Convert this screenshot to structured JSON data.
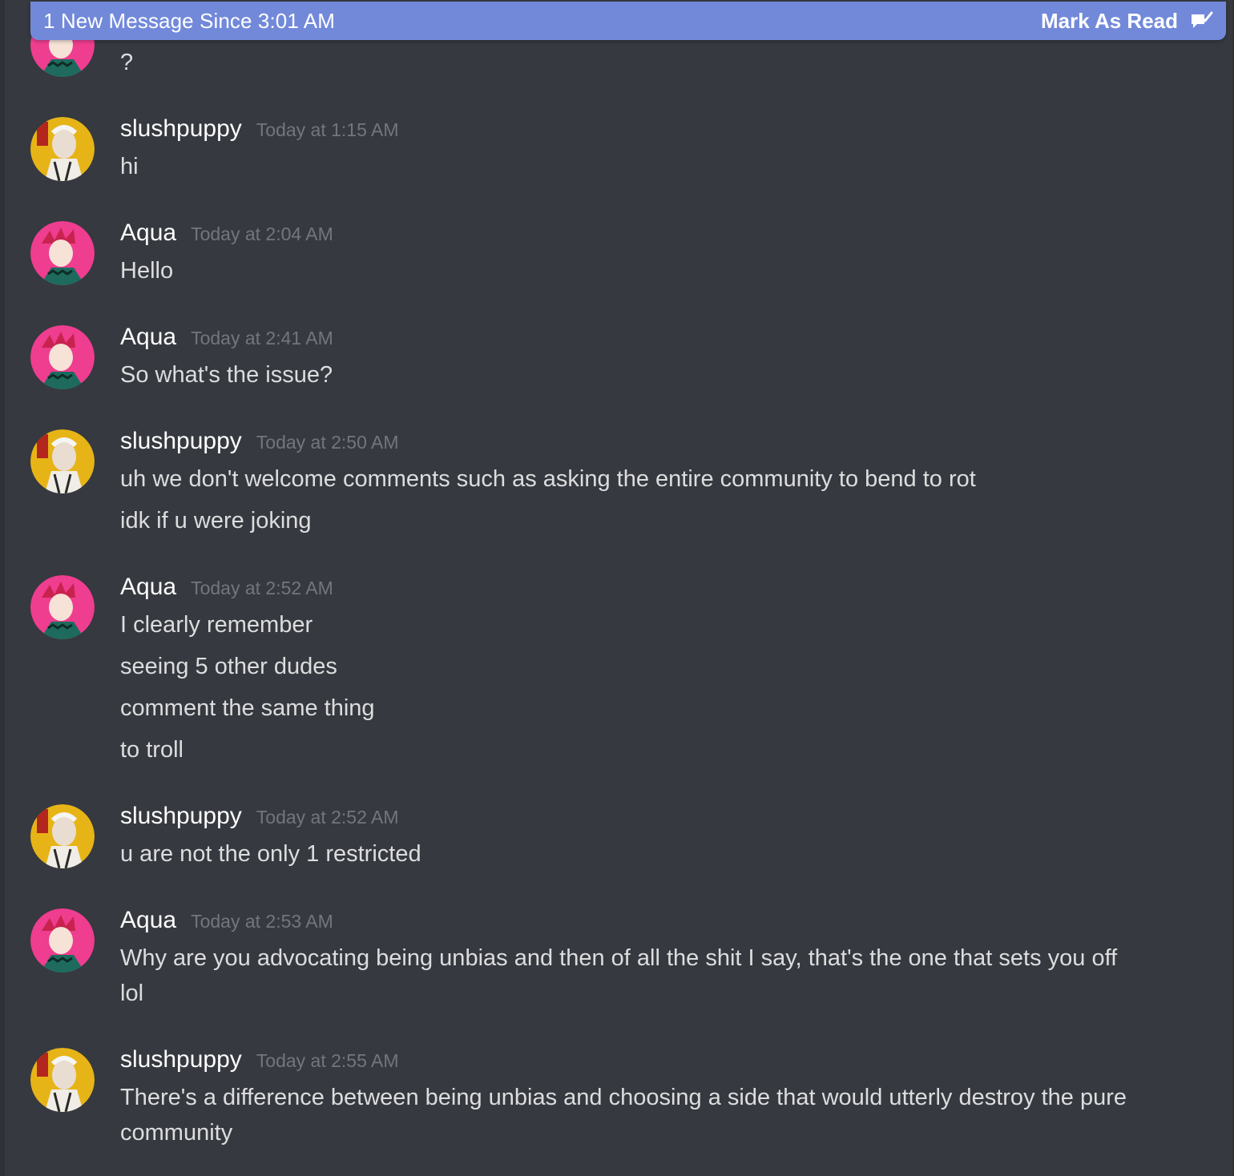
{
  "banner": {
    "text": "1 New Message Since 3:01 AM",
    "action_label": "Mark As Read",
    "color": "#7289da"
  },
  "colors": {
    "background": "#36393f",
    "username": "#ffffff",
    "timestamp": "#72767d",
    "message_text": "#dcddde",
    "aqua_avatar": "#ef3d8f",
    "slushpuppy_avatar": "#e7b417"
  },
  "partial_message": {
    "author": "Aqua",
    "lines": [
      "?"
    ]
  },
  "messages": [
    {
      "author": "slushpuppy",
      "time": "Today at 1:15 AM",
      "lines": [
        "hi"
      ]
    },
    {
      "author": "Aqua",
      "time": "Today at 2:04 AM",
      "lines": [
        "Hello"
      ]
    },
    {
      "author": "Aqua",
      "time": "Today at 2:41 AM",
      "lines": [
        "So what's the issue?"
      ]
    },
    {
      "author": "slushpuppy",
      "time": "Today at 2:50 AM",
      "lines": [
        "uh we don't welcome comments such as asking the entire community to bend to rot",
        "idk if u were joking"
      ]
    },
    {
      "author": "Aqua",
      "time": "Today at 2:52 AM",
      "lines": [
        "I clearly remember",
        "seeing 5 other dudes",
        "comment the same thing",
        "to troll"
      ]
    },
    {
      "author": "slushpuppy",
      "time": "Today at 2:52 AM",
      "lines": [
        "u are not the only 1 restricted"
      ]
    },
    {
      "author": "Aqua",
      "time": "Today at 2:53 AM",
      "lines": [
        "Why are you advocating being unbias and then of all the shit I say, that's the one that sets you off lol"
      ]
    },
    {
      "author": "slushpuppy",
      "time": "Today at 2:55 AM",
      "lines": [
        "There's a difference between being unbias and choosing a side that would utterly destroy the pure community"
      ]
    }
  ]
}
